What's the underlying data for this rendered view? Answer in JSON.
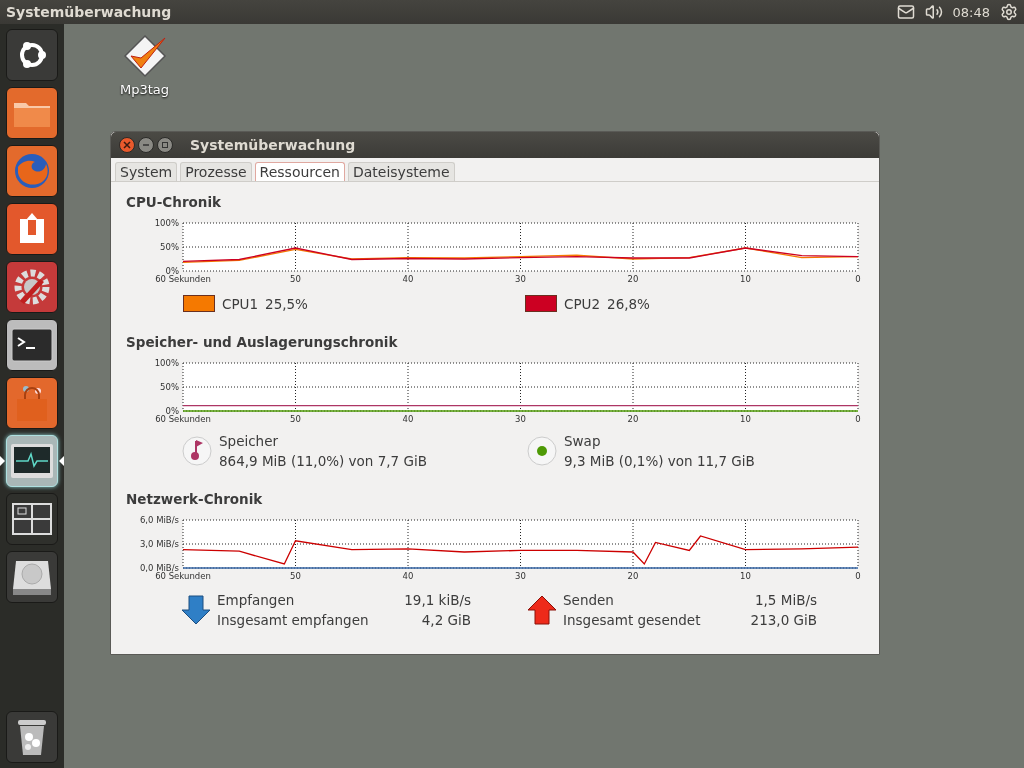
{
  "top_panel": {
    "title": "Systemüberwachung",
    "clock": "08:48"
  },
  "launcher": [
    {
      "kind": "dash",
      "selected": false
    },
    {
      "kind": "files",
      "selected": false
    },
    {
      "kind": "firefox",
      "selected": false
    },
    {
      "kind": "ubuntuone",
      "selected": false
    },
    {
      "kind": "settings",
      "selected": false
    },
    {
      "kind": "terminal",
      "selected": false
    },
    {
      "kind": "software",
      "selected": false
    },
    {
      "kind": "monitor",
      "selected": true
    },
    {
      "kind": "workspaces",
      "selected": false
    },
    {
      "kind": "disk",
      "selected": false
    },
    {
      "kind": "trash",
      "selected": false
    }
  ],
  "desktop_icons": [
    {
      "label": "Mp3tag"
    }
  ],
  "window": {
    "title": "Systemüberwachung",
    "tabs": [
      {
        "label": "System",
        "selected": false
      },
      {
        "label": "Prozesse",
        "selected": false
      },
      {
        "label": "Ressourcen",
        "selected": true
      },
      {
        "label": "Dateisysteme",
        "selected": false
      }
    ],
    "cpu": {
      "title": "CPU-Chronik",
      "chart_data": {
        "type": "line",
        "grid": true,
        "x": [
          60,
          55,
          50,
          45,
          40,
          35,
          30,
          25,
          20,
          15,
          10,
          5,
          0
        ],
        "xlim": [
          60,
          0
        ],
        "ylim": [
          0,
          100
        ],
        "xticks": [
          {
            "value": 60,
            "label": "60 Sekunden"
          },
          50,
          40,
          30,
          20,
          10,
          0
        ],
        "yticks": [
          {
            "value": 0,
            "label": "0%"
          },
          {
            "value": 50,
            "label": "50%"
          },
          {
            "value": 100,
            "label": "100%"
          }
        ],
        "series": [
          {
            "name": "CPU1",
            "color": "#f57900",
            "values": [
              18,
              22,
              45,
              25,
              28,
              27,
              30,
              33,
              25,
              28,
              48,
              28,
              30
            ]
          },
          {
            "name": "CPU2",
            "color": "#cc0022",
            "values": [
              20,
              24,
              48,
              24,
              26,
              25,
              28,
              30,
              27,
              27,
              48,
              32,
              30
            ]
          }
        ]
      },
      "legend": [
        {
          "value": "25,5%"
        },
        {
          "value": "26,8%"
        }
      ]
    },
    "memory": {
      "title": "Speicher- und Auslagerungschronik",
      "chart_data": {
        "type": "line",
        "grid": true,
        "x": [
          60,
          0
        ],
        "xlim": [
          60,
          0
        ],
        "ylim": [
          0,
          100
        ],
        "xticks": [
          {
            "value": 60,
            "label": "60 Sekunden"
          },
          50,
          40,
          30,
          20,
          10,
          0
        ],
        "yticks": [
          {
            "value": 0,
            "label": "0%"
          },
          {
            "value": 50,
            "label": "50%"
          },
          {
            "value": 100,
            "label": "100%"
          }
        ],
        "series": [
          {
            "name": "Speicher",
            "color": "#ad3564",
            "values": [
              11,
              11
            ]
          },
          {
            "name": "Swap",
            "color": "#4e9a06",
            "values": [
              0,
              0
            ]
          }
        ]
      },
      "items": [
        {
          "kind": "memory",
          "detail": "864,9 MiB (11,0%) von 7,7 GiB"
        },
        {
          "kind": "swap",
          "detail": "9,3 MiB (0,1%) von 11,7 GiB"
        }
      ]
    },
    "network": {
      "title": "Netzwerk-Chronik",
      "chart_data": {
        "type": "line",
        "grid": true,
        "x": [
          60,
          55,
          51,
          50,
          45,
          40,
          35,
          30,
          25,
          20,
          19,
          18,
          15,
          14,
          10,
          5,
          0
        ],
        "xlim": [
          60,
          0
        ],
        "ylim": [
          0,
          6
        ],
        "xticks": [
          {
            "value": 60,
            "label": "60 Sekunden"
          },
          50,
          40,
          30,
          20,
          10,
          0
        ],
        "yticks": [
          {
            "value": 0,
            "label": "0,0 MiB/s"
          },
          {
            "value": 3,
            "label": "3,0 MiB/s"
          },
          {
            "value": 6,
            "label": "6,0 MiB/s"
          }
        ],
        "series": [
          {
            "name": "Empfangen",
            "color": "#3465a4",
            "values": [
              0,
              0,
              0,
              0,
              0,
              0,
              0,
              0,
              0,
              0,
              0,
              0,
              0,
              0,
              0,
              0,
              0
            ]
          },
          {
            "name": "Senden",
            "color": "#cc0000",
            "values": [
              2.3,
              2.1,
              0.5,
              3.4,
              2.3,
              2.4,
              2.0,
              2.2,
              2.2,
              2.0,
              0.5,
              3.2,
              2.2,
              4.0,
              2.3,
              2.4,
              2.6
            ]
          }
        ]
      },
      "items": [
        {
          "kind": "down",
          "value": "19,1 kiB/s",
          "total_label": "Insgesamt empfangen",
          "total_value": "4,2 GiB"
        },
        {
          "kind": "up",
          "value": "1,5 MiB/s",
          "total_label": "Insgesamt gesendet",
          "total_value": "213,0 GiB"
        }
      ]
    }
  }
}
